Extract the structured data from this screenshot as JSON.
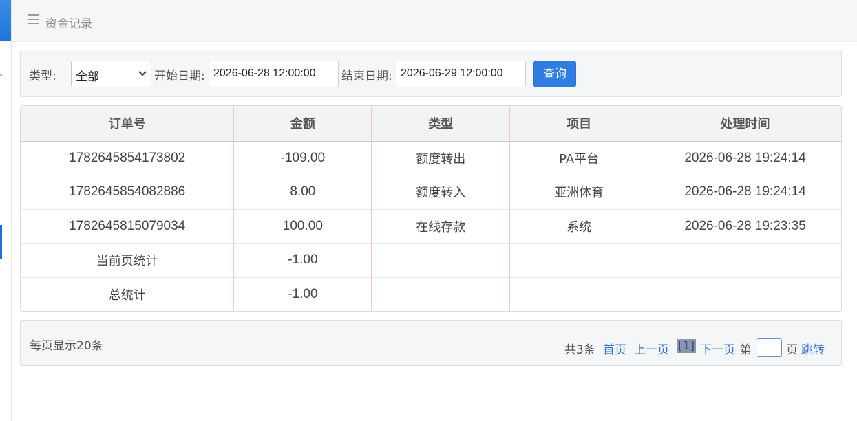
{
  "header": {
    "title": "资金记录"
  },
  "filter": {
    "type_label": "类型:",
    "type_selected": "全部",
    "start_label": "开始日期:",
    "start_value": "2026-06-28 12:00:00",
    "end_label": "结束日期:",
    "end_value": "2026-06-29 12:00:00",
    "query_label": "查询"
  },
  "table": {
    "headers": [
      "订单号",
      "金额",
      "类型",
      "项目",
      "处理时间"
    ],
    "rows": [
      [
        "1782645854173802",
        "-109.00",
        "额度转出",
        "PA平台",
        "2026-06-28 19:24:14"
      ],
      [
        "1782645854082886",
        "8.00",
        "额度转入",
        "亚洲体育",
        "2026-06-28 19:24:14"
      ],
      [
        "1782645815079034",
        "100.00",
        "在线存款",
        "系统",
        "2026-06-28 19:23:35"
      ],
      [
        "当前页统计",
        "-1.00",
        "",
        "",
        ""
      ],
      [
        "总统计",
        "-1.00",
        "",
        "",
        ""
      ]
    ]
  },
  "pager": {
    "per_page": "每页显示20条",
    "total": "共3条",
    "first": "首页",
    "prev": "上一页",
    "current": "[1]",
    "next": "下一页",
    "page_prefix": "第",
    "page_suffix": "页",
    "jump": "跳转"
  },
  "colors": {
    "accent": "#2f7de1",
    "link": "#2f6fd6"
  }
}
